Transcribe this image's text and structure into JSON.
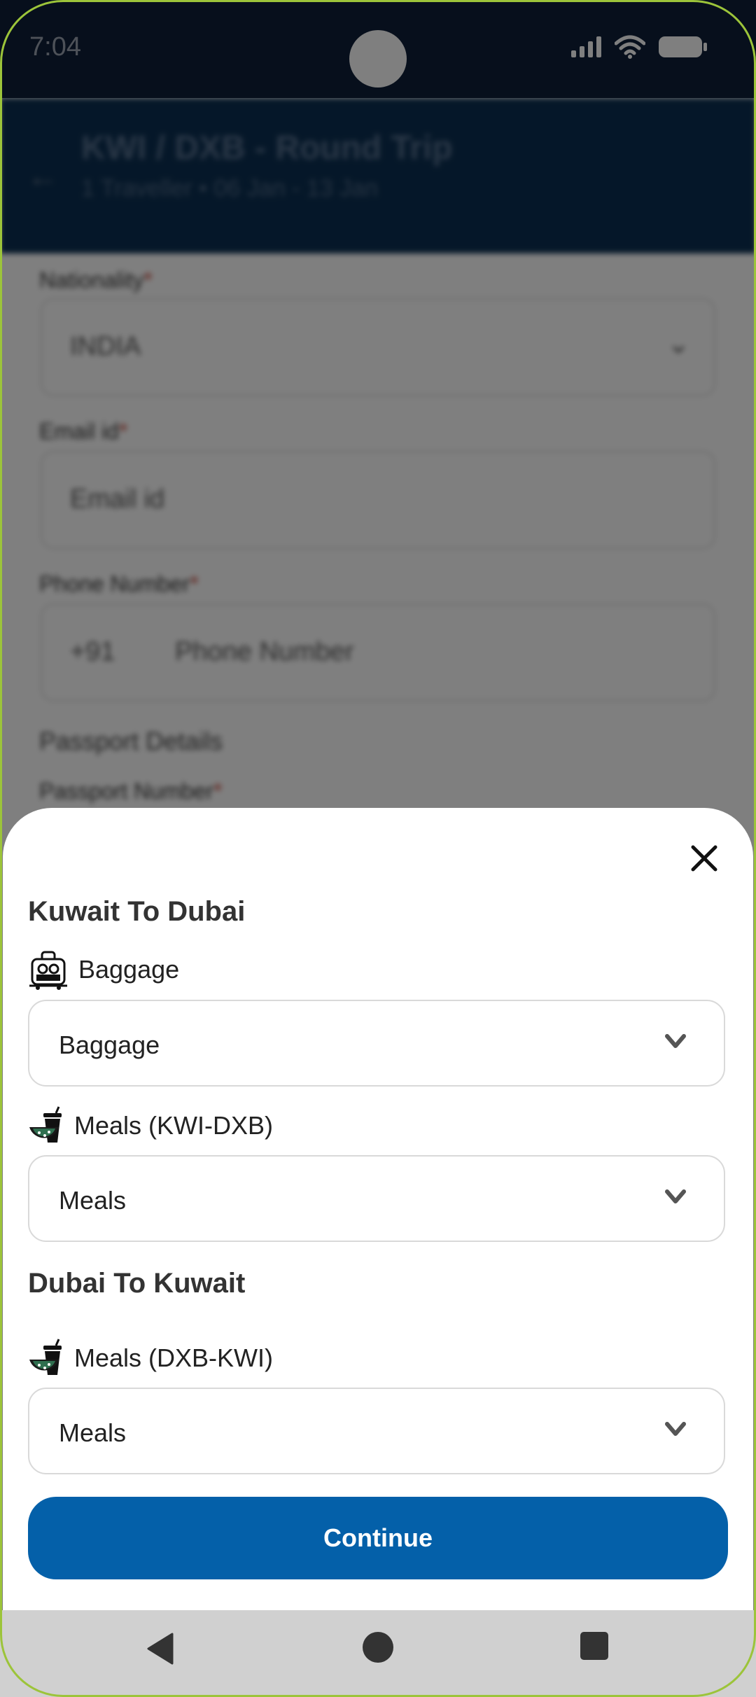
{
  "status_bar": {
    "time": "7:04"
  },
  "background_screen": {
    "header_title": "KWI / DXB - Round Trip",
    "header_subtitle": "1 Traveller • 06 Jan - 13 Jan",
    "nationality_label": "Nationality",
    "nationality_value": "INDIA",
    "email_label": "Email id",
    "email_placeholder": "Email id",
    "phone_label": "Phone Number",
    "phone_code": "+91",
    "phone_placeholder": "Phone Number",
    "passport_section": "Passport Details",
    "passport_label": "Passport Number"
  },
  "sheet": {
    "outbound_title": "Kuwait To Dubai",
    "baggage_label": "Baggage",
    "baggage_select": "Baggage",
    "outbound_meals_label": "Meals (KWI-DXB)",
    "outbound_meals_select": "Meals",
    "return_title": "Dubai To Kuwait",
    "return_meals_label": "Meals (DXB-KWI)",
    "return_meals_select": "Meals",
    "continue_label": "Continue"
  },
  "colors": {
    "primary": "#0460a9",
    "status_bar": "#0e1f38",
    "header": "#0b2f52",
    "nav_bar": "#d0d0d0"
  }
}
